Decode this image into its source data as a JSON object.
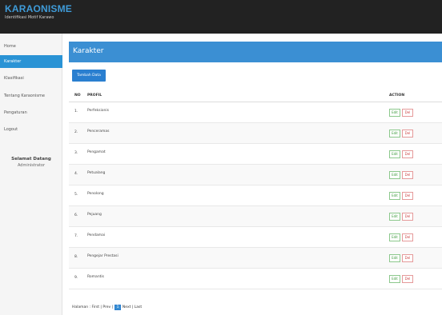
{
  "brand": {
    "title": "KARAONISME",
    "subtitle": "Identifikasi Motif Karawo"
  },
  "sidebar": {
    "items": [
      {
        "label": "Home",
        "active": false
      },
      {
        "label": "Karakter",
        "active": true
      },
      {
        "label": "Klasifikasi",
        "active": false
      },
      {
        "label": "Tentang Karaonisme",
        "active": false
      },
      {
        "label": "Pengaturan",
        "active": false
      },
      {
        "label": "Logout",
        "active": false
      }
    ],
    "welcome_title": "Selamat Datang",
    "welcome_user": "Administrator"
  },
  "panel": {
    "title": "Karakter",
    "add_button": "Tambah Data"
  },
  "table": {
    "headers": {
      "no": "NO",
      "profil": "PROFIL",
      "action": "ACTION"
    },
    "rows": [
      {
        "no": "1.",
        "name": "Perfeksionis"
      },
      {
        "no": "2.",
        "name": "Penceramas"
      },
      {
        "no": "3.",
        "name": "Pengamat"
      },
      {
        "no": "4.",
        "name": "Petualang"
      },
      {
        "no": "5.",
        "name": "Penolong"
      },
      {
        "no": "6.",
        "name": "Pejuang"
      },
      {
        "no": "7.",
        "name": "Pendamai"
      },
      {
        "no": "8.",
        "name": "Pengejar Prestasi"
      },
      {
        "no": "9.",
        "name": "Romantis"
      }
    ],
    "edit_label": "Edit",
    "del_label": "Del"
  },
  "pagination": {
    "prefix": "Halaman : First | Prev |",
    "current": "1",
    "suffix": "Next | Last"
  },
  "colors": {
    "accent": "#3b8fd3",
    "topbar": "#222222",
    "brand": "#3f9bd8"
  }
}
